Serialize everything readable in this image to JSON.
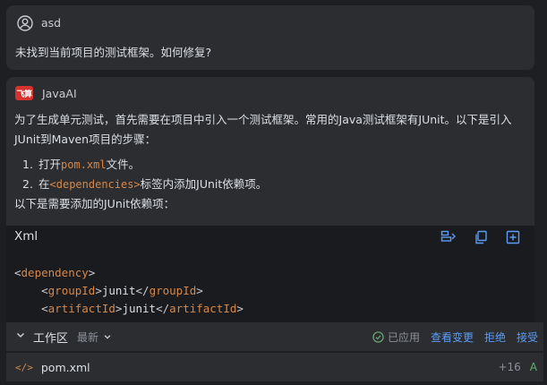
{
  "user": {
    "name": "asd",
    "message": "未找到当前项目的测试框架。如何修复?"
  },
  "assistant": {
    "logo_text": "飞算",
    "name": "JavaAI",
    "intro": "为了生成单元测试，首先需要在项目中引入一个测试框架。常用的Java测试框架有JUnit。以下是引入JUnit到Maven项目的步骤：",
    "steps": [
      {
        "num": "1.",
        "before": "打开",
        "code": "pom.xml",
        "after": "文件。"
      },
      {
        "num": "2.",
        "before": "在",
        "code": "<dependencies>",
        "after": "标签内添加JUnit依赖项。"
      }
    ],
    "outro": "以下是需要添加的JUnit依赖项："
  },
  "code_block": {
    "language": "Xml",
    "tools": [
      "insert-at-cursor-icon",
      "copy-icon",
      "new-file-icon"
    ],
    "lines": [
      {
        "indent": "",
        "open": "dependency",
        "text": "",
        "close": ""
      },
      {
        "indent": "    ",
        "open": "groupId",
        "text": "junit",
        "close": "groupId"
      },
      {
        "indent": "    ",
        "open": "artifactId",
        "text": "junit",
        "close": "artifactId"
      }
    ]
  },
  "workspace": {
    "title": "工作区",
    "filter": "最新",
    "applied": "已应用",
    "view_changes": "查看变更",
    "reject": "拒绝",
    "accept": "接受"
  },
  "file": {
    "name": "pom.xml",
    "diff": "+16",
    "status": "A"
  },
  "colors": {
    "background": "#1e1f22",
    "card": "#2b2d30",
    "code_bg": "#1a1b1e",
    "accent": "#5c9cf5",
    "tag": "#d6884a",
    "success": "#6aab73",
    "logo": "#d9312e"
  }
}
